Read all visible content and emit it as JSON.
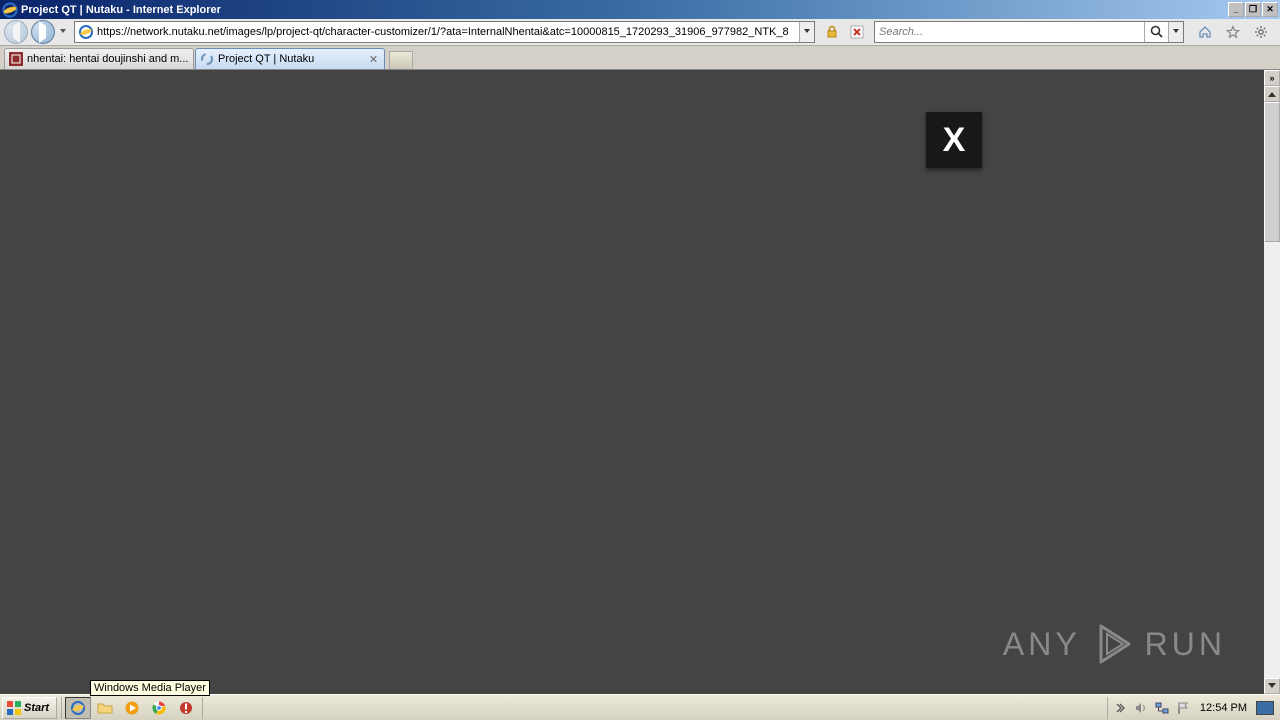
{
  "window": {
    "title": "Project QT | Nutaku - Internet Explorer"
  },
  "toolbar": {
    "url": "https://network.nutaku.net/images/lp/project-qt/character-customizer/1/?ata=InternalNhentai&atc=10000815_1720293_31906_977982_NTK_8",
    "search_placeholder": "Search...",
    "icons": {
      "back": "back-icon",
      "forward": "forward-icon",
      "lock": "lock-icon",
      "stop": "stop-icon",
      "search": "search-icon",
      "home": "home-icon",
      "favorites": "star-icon",
      "tools": "gear-icon"
    }
  },
  "tabs": [
    {
      "title": "nhentai: hentai doujinshi and m...",
      "active": false,
      "loading": false
    },
    {
      "title": "Project QT | Nutaku",
      "active": true,
      "loading": true
    }
  ],
  "content": {
    "ad_close_label": "X",
    "watermark_left": "ANY",
    "watermark_right": "RUN"
  },
  "tooltip": {
    "text": "Windows Media Player"
  },
  "taskbar": {
    "start_label": "Start",
    "clock": "12:54 PM",
    "quicklaunch": [
      "ie",
      "explorer",
      "wmp",
      "chrome",
      "shield"
    ],
    "tray": [
      "chevrons",
      "volume",
      "network",
      "flag"
    ]
  }
}
